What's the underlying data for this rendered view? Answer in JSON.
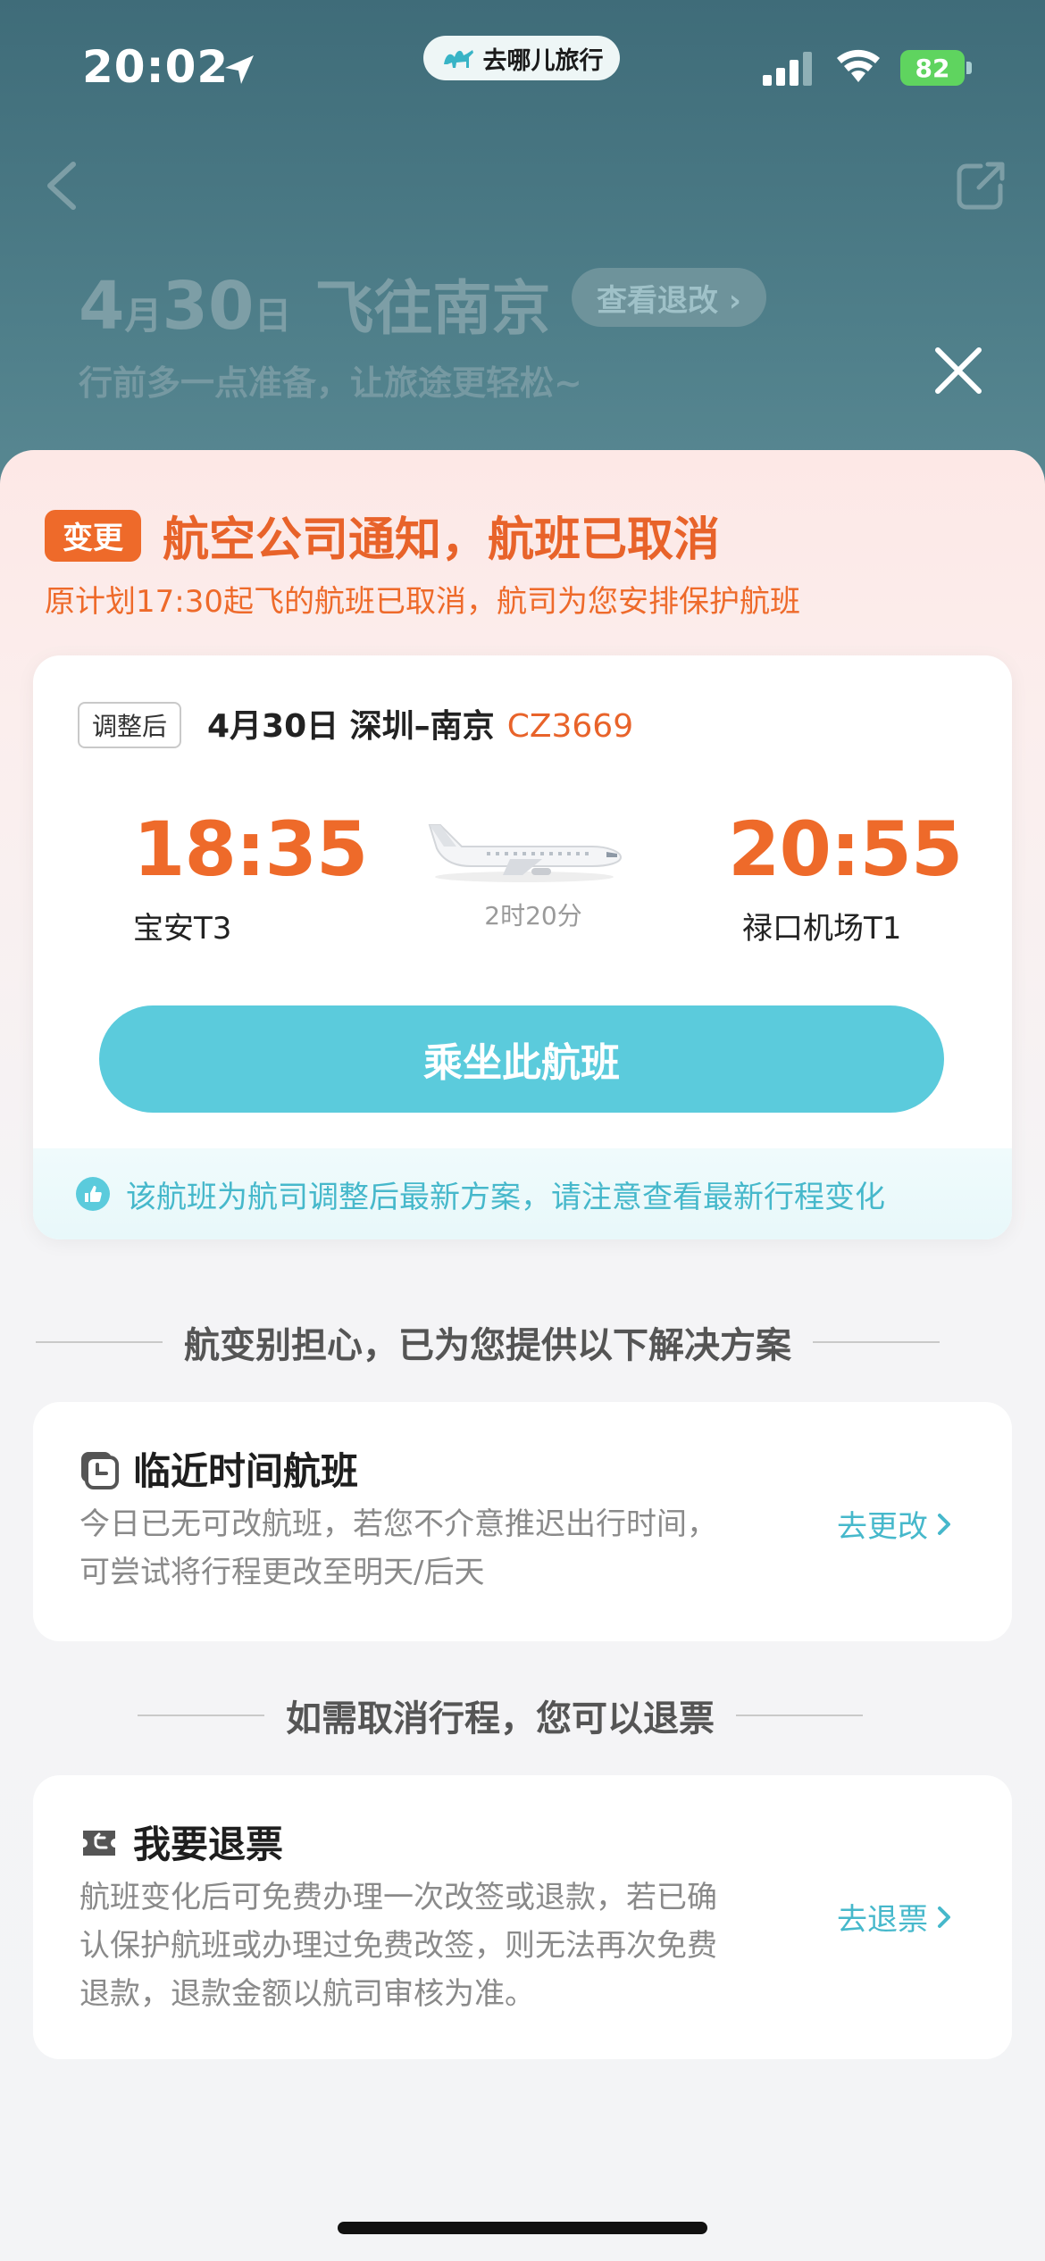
{
  "status_bar": {
    "time": "20:02",
    "app_pill": "去哪儿旅行",
    "battery": "82"
  },
  "background": {
    "day": "4",
    "month_unit": "月",
    "date": "30",
    "day_unit": "日",
    "destination": "飞往南京",
    "chip": "查看退改 ›",
    "subtitle": "行前多一点准备，让旅途更轻松~"
  },
  "notice": {
    "badge": "变更",
    "title": "航空公司通知，航班已取消",
    "desc": "原计划17:30起飞的航班已取消，航司为您安排保护航班"
  },
  "flight": {
    "tag": "调整后",
    "route": "4月30日  深圳–南京",
    "flight_no": "CZ3669",
    "dep_time": "18:35",
    "dep_airport": "宝安T3",
    "arr_time": "20:55",
    "arr_airport": "禄口机场T1",
    "duration": "2时20分",
    "take_button": "乘坐此航班",
    "tip": "该航班为航司调整后最新方案，请注意查看最新行程变化"
  },
  "solutions": {
    "heading": "航变别担心，已为您提供以下解决方案",
    "option1": {
      "title": "临近时间航班",
      "desc": "今日已无可改航班，若您不介意推迟出行时间，可尝试将行程更改至明天/后天",
      "action": "去更改"
    }
  },
  "refund": {
    "heading": "如需取消行程，您可以退票",
    "option": {
      "title": "我要退票",
      "desc": "航班变化后可免费办理一次改签或退款，若已确认保护航班或办理过免费改签，则无法再次免费退款，退款金额以航司审核为准。",
      "action": "去退票"
    }
  },
  "colors": {
    "accent_orange": "#ee6a2a",
    "accent_teal": "#5bcbdc"
  }
}
